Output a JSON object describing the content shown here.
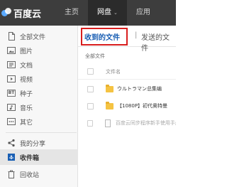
{
  "topbar": {
    "logo_text": "百度云",
    "nav": [
      {
        "label": "主页"
      },
      {
        "label": "网盘",
        "caret": "⌄"
      },
      {
        "label": "应用"
      }
    ]
  },
  "sidebar": {
    "items": [
      {
        "label": "全部文件",
        "icon": "page-icon"
      },
      {
        "label": "图片",
        "icon": "image-icon"
      },
      {
        "label": "文档",
        "icon": "document-icon"
      },
      {
        "label": "视频",
        "icon": "video-icon"
      },
      {
        "label": "种子",
        "icon": "bt-icon",
        "badge": "BT"
      },
      {
        "label": "音乐",
        "icon": "music-icon"
      },
      {
        "label": "其它",
        "icon": "more-icon"
      },
      {
        "label": "我的分享",
        "icon": "share-icon"
      },
      {
        "label": "收件箱",
        "icon": "inbox-icon"
      },
      {
        "label": "回收站",
        "icon": "trash-icon"
      }
    ]
  },
  "main": {
    "tabs": {
      "received": "收到的文件",
      "divider": "|",
      "sent": "发送的文件"
    },
    "breadcrumb": "全部文件",
    "column_name": "文件名",
    "rows": [
      {
        "name": "ウルトラマン总集编",
        "type": "folder"
      },
      {
        "name": "【1080P】初代奥特曼",
        "type": "folder"
      },
      {
        "name": "百度云同步程序新手使用手册.m",
        "type": "file"
      }
    ]
  },
  "colors": {
    "topbar": "#3d3d3d",
    "active_tab": "#1a5fb4",
    "highlight": "#d81e1e",
    "folder": "#f5c342"
  }
}
